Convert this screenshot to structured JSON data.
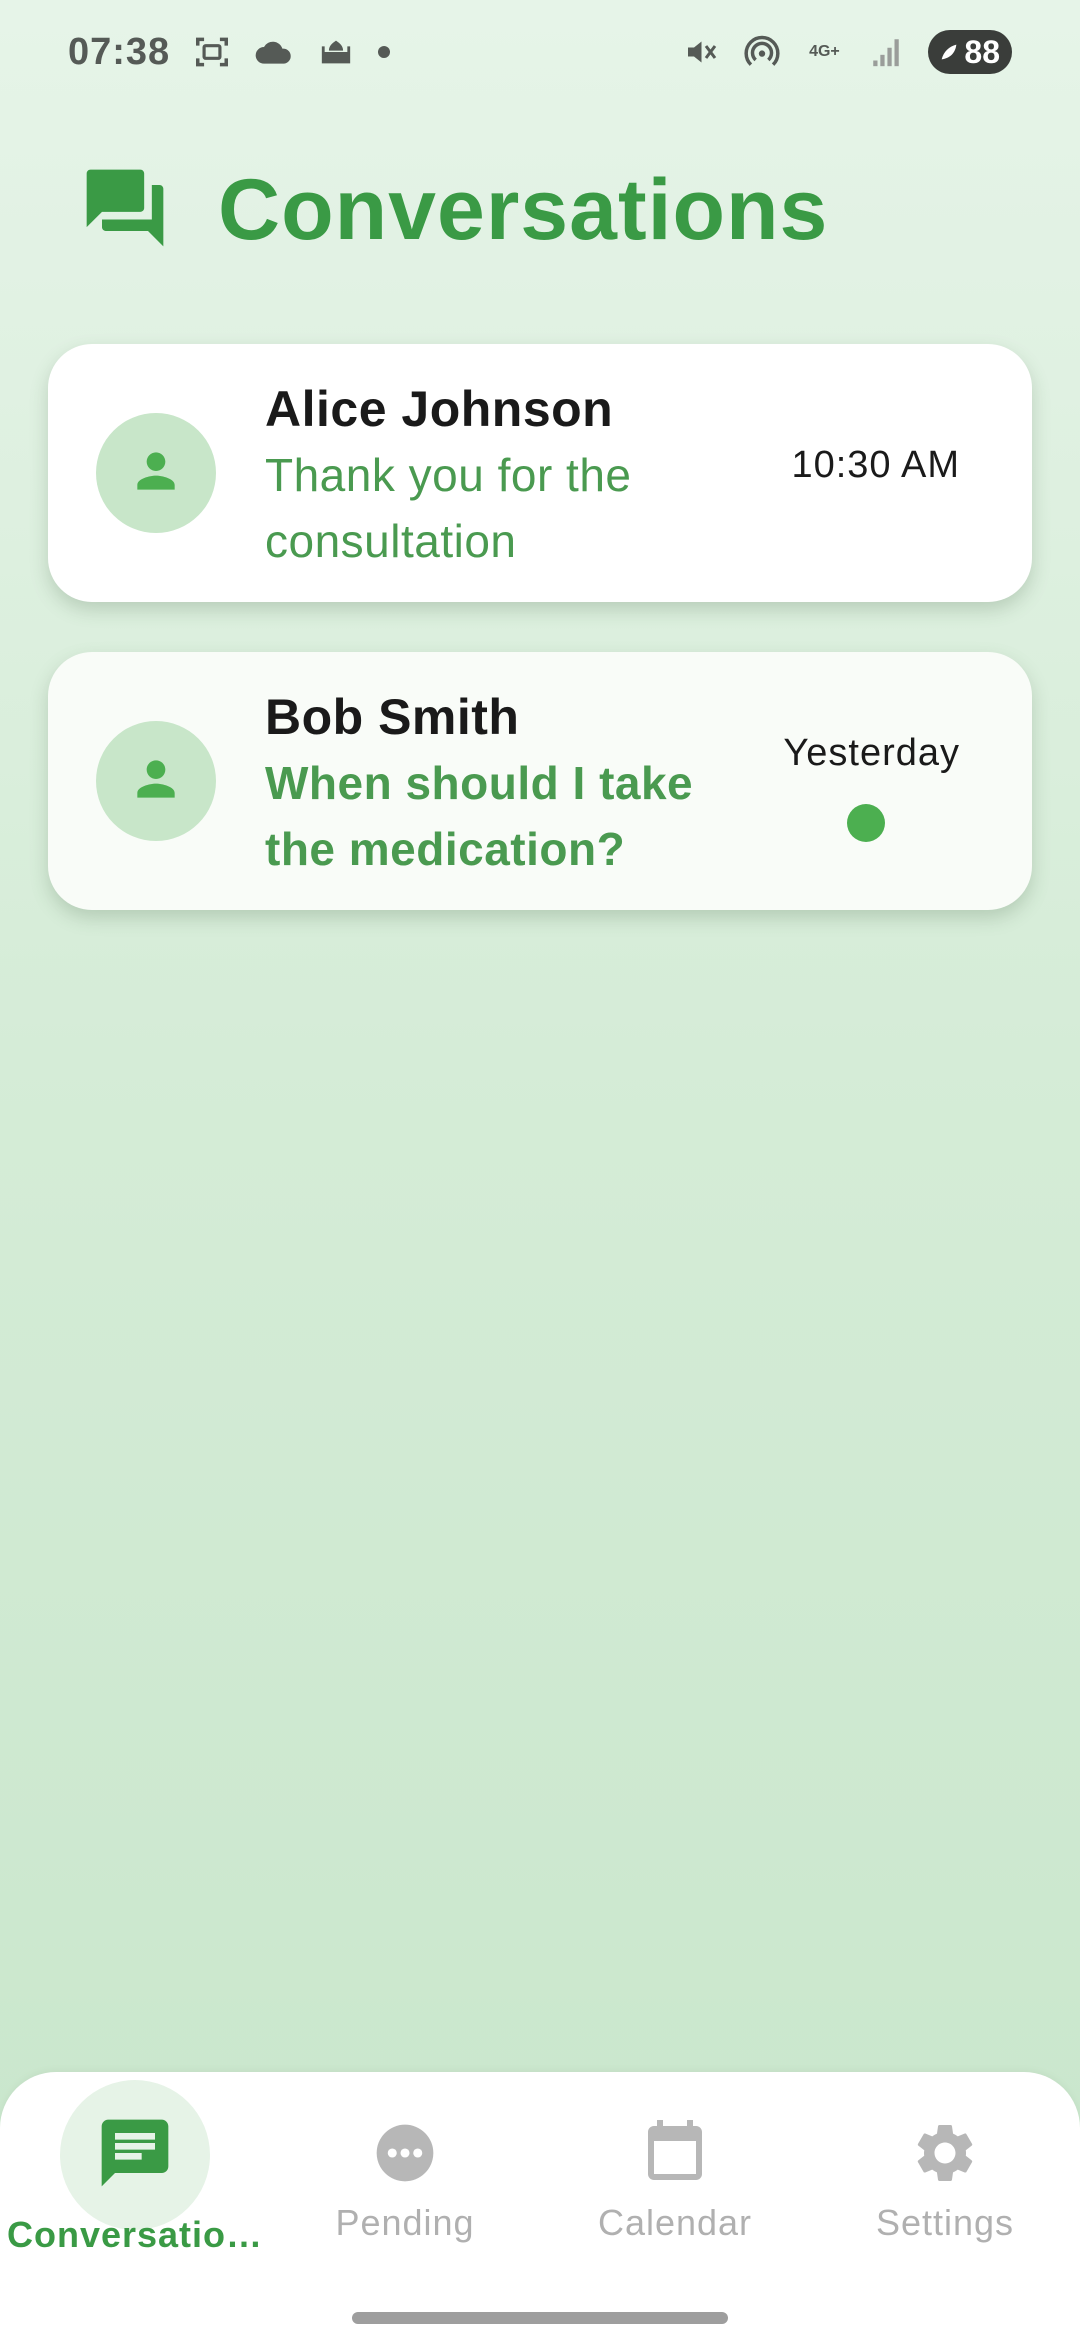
{
  "status_bar": {
    "time": "07:38",
    "network_label": "4G+",
    "battery": "88",
    "icons": [
      "screenshot-icon",
      "cloud-icon",
      "mosque-icon",
      "notification-dot",
      "mute-icon",
      "hotspot-icon",
      "network-icon",
      "signal-icon",
      "battery-icon"
    ]
  },
  "header": {
    "title": "Conversations",
    "icon": "chat-bubbles-icon"
  },
  "conversations": [
    {
      "name": "Alice Johnson",
      "message": "Thank you for the consultation",
      "time": "10:30 AM",
      "unread": false,
      "avatar_icon": "person-icon"
    },
    {
      "name": "Bob Smith",
      "message": "When should I take the medication?",
      "time": "Yesterday",
      "unread": true,
      "avatar_icon": "person-icon"
    }
  ],
  "bottom_nav": {
    "items": [
      {
        "label": "Conversatio…",
        "icon": "message-icon",
        "active": true
      },
      {
        "label": "Pending",
        "icon": "more-horiz-icon",
        "active": false
      },
      {
        "label": "Calendar",
        "icon": "calendar-icon",
        "active": false
      },
      {
        "label": "Settings",
        "icon": "gear-icon",
        "active": false
      }
    ]
  },
  "colors": {
    "accent": "#3a9a45",
    "unread_dot": "#4caf50",
    "avatar_bg": "#c8e6c9",
    "inactive_nav": "#b0b0b0"
  }
}
